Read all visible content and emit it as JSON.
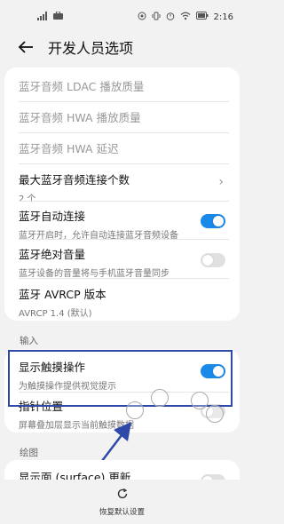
{
  "status_bar": {
    "time": "2:16"
  },
  "header": {
    "title": "开发人员选项"
  },
  "items": {
    "ldac": {
      "label": "蓝牙音频 LDAC 播放质量"
    },
    "hwa_quality": {
      "label": "蓝牙音频 HWA 播放质量"
    },
    "hwa_delay": {
      "label": "蓝牙音频 HWA 延迟"
    },
    "max_connections": {
      "label": "最大蓝牙音频连接个数",
      "value": "2 个"
    },
    "auto_connect": {
      "label": "蓝牙自动连接",
      "sub": "蓝牙开启时，允许自动连接蓝牙音频设备",
      "state": "on"
    },
    "absolute_volume": {
      "label": "蓝牙绝对音量",
      "sub": "蓝牙设备的音量将与手机蓝牙音量同步",
      "state": "off"
    },
    "avrcp": {
      "label": "蓝牙 AVRCP 版本",
      "value": "AVRCP 1.4 (默认)"
    }
  },
  "input_section": {
    "header": "输入",
    "show_taps": {
      "label": "显示触摸操作",
      "sub": "为触摸操作提供视觉提示",
      "state": "on"
    },
    "pointer_location": {
      "label": "指针位置",
      "sub": "屏幕叠加层显示当前触摸数据",
      "state": "off"
    }
  },
  "drawing_section": {
    "header": "绘图",
    "surface_updates": {
      "label": "显示面 (surface) 更新"
    }
  },
  "bottom": {
    "reset_label": "恢复默认设置"
  },
  "colors": {
    "accent": "#1a89e8",
    "highlight": "#2f49a8",
    "arrow": "#2f49a8"
  }
}
